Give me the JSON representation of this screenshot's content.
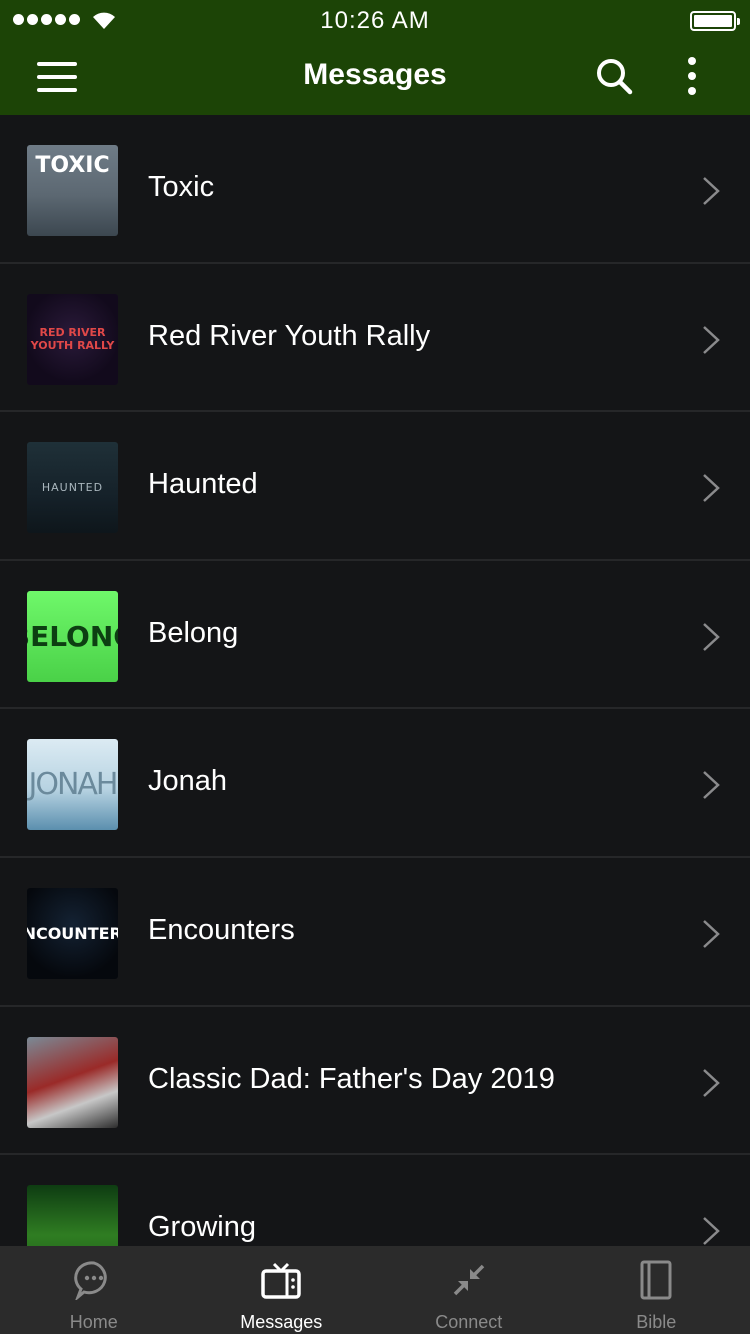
{
  "status_bar": {
    "time": "10:26 AM"
  },
  "header": {
    "title": "Messages"
  },
  "messages": [
    {
      "title": "Toxic",
      "thumb_text": "TOXIC"
    },
    {
      "title": "Red River Youth Rally",
      "thumb_text": "RED RIVER YOUTH RALLY"
    },
    {
      "title": "Haunted",
      "thumb_text": "HAUNTED"
    },
    {
      "title": "Belong",
      "thumb_text": "BELONG"
    },
    {
      "title": "Jonah",
      "thumb_text": "JONAH"
    },
    {
      "title": "Encounters",
      "thumb_text": "ENCOUNTERS"
    },
    {
      "title": "Classic Dad: Father's Day 2019",
      "thumb_text": ""
    },
    {
      "title": "Growing",
      "thumb_text": ""
    }
  ],
  "tabs": [
    {
      "label": "Home",
      "icon": "chat-bubble-icon",
      "active": false
    },
    {
      "label": "Messages",
      "icon": "tv-icon",
      "active": true
    },
    {
      "label": "Connect",
      "icon": "connect-arrows-icon",
      "active": false
    },
    {
      "label": "Bible",
      "icon": "book-icon",
      "active": false
    }
  ],
  "colors": {
    "header": "#1c4406",
    "background": "#141517",
    "tabbar": "#2b2b2b"
  }
}
